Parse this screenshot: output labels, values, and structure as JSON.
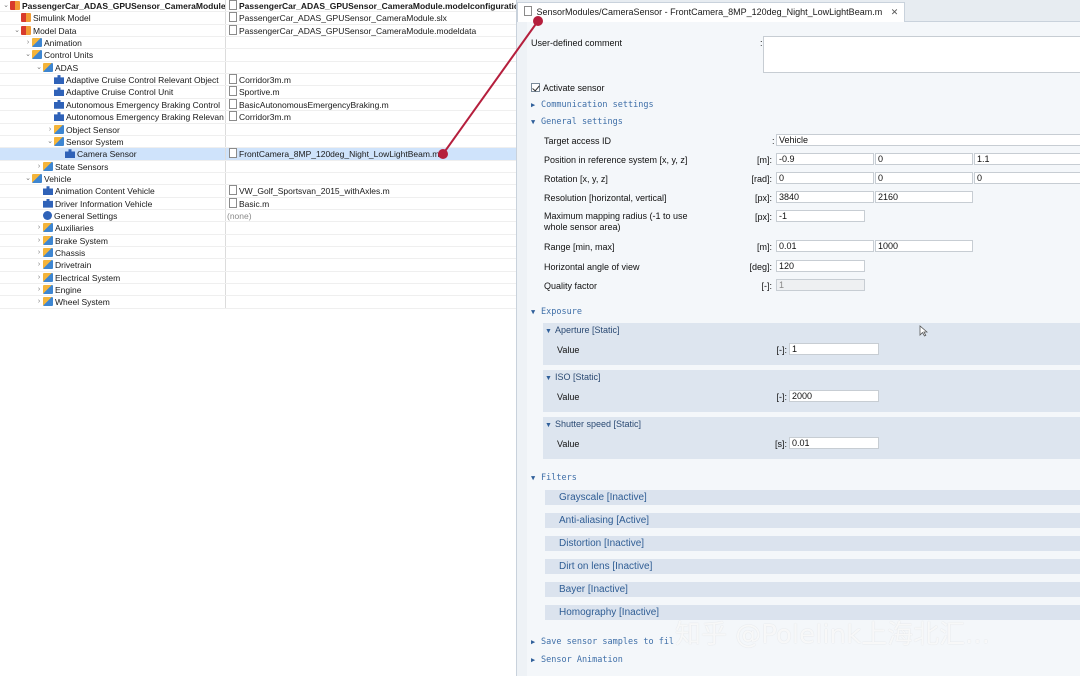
{
  "tree": {
    "rows": [
      {
        "indent": 0,
        "twisty": "v",
        "icon": "model",
        "name": "PassengerCar_ADAS_GPUSensor_CameraModule",
        "value": "PassengerCar_ADAS_GPUSensor_CameraModule.modelconfiguration",
        "bold": true
      },
      {
        "indent": 1,
        "twisty": "",
        "icon": "model",
        "name": "Simulink Model",
        "value": "PassengerCar_ADAS_GPUSensor_CameraModule.slx"
      },
      {
        "indent": 1,
        "twisty": "v",
        "icon": "model",
        "name": "Model Data",
        "value": "PassengerCar_ADAS_GPUSensor_CameraModule.modeldata"
      },
      {
        "indent": 2,
        "twisty": ">",
        "icon": "folder",
        "name": "Animation",
        "value": ""
      },
      {
        "indent": 2,
        "twisty": "v",
        "icon": "folder",
        "name": "Control Units",
        "value": ""
      },
      {
        "indent": 3,
        "twisty": "v",
        "icon": "folder",
        "name": "ADAS",
        "value": ""
      },
      {
        "indent": 4,
        "twisty": "",
        "icon": "puzzle",
        "name": "Adaptive Cruise Control Relevant Object",
        "value": "Corridor3m.m"
      },
      {
        "indent": 4,
        "twisty": "",
        "icon": "puzzle",
        "name": "Adaptive Cruise Control Unit",
        "value": "Sportive.m"
      },
      {
        "indent": 4,
        "twisty": "",
        "icon": "puzzle",
        "name": "Autonomous Emergency Braking Control",
        "value": "BasicAutonomousEmergencyBraking.m"
      },
      {
        "indent": 4,
        "twisty": "",
        "icon": "puzzle",
        "name": "Autonomous Emergency Braking Relevan",
        "value": "Corridor3m.m"
      },
      {
        "indent": 4,
        "twisty": ">",
        "icon": "folder",
        "name": "Object Sensor",
        "value": ""
      },
      {
        "indent": 4,
        "twisty": "v",
        "icon": "folder",
        "name": "Sensor System",
        "value": ""
      },
      {
        "indent": 5,
        "twisty": "",
        "icon": "puzzle",
        "name": "Camera Sensor",
        "value": "FrontCamera_8MP_120deg_Night_LowLightBeam.m",
        "selected": true
      },
      {
        "indent": 3,
        "twisty": ">",
        "icon": "folder",
        "name": "State Sensors",
        "value": ""
      },
      {
        "indent": 2,
        "twisty": "v",
        "icon": "folder",
        "name": "Vehicle",
        "value": ""
      },
      {
        "indent": 3,
        "twisty": "",
        "icon": "puzzle",
        "name": "Animation Content Vehicle",
        "value": "VW_Golf_Sportsvan_2015_withAxles.m"
      },
      {
        "indent": 3,
        "twisty": "",
        "icon": "puzzle",
        "name": "Driver Information Vehicle",
        "value": "Basic.m"
      },
      {
        "indent": 3,
        "twisty": "",
        "icon": "gear",
        "name": "General Settings",
        "value": "(none)",
        "none": true
      },
      {
        "indent": 3,
        "twisty": ">",
        "icon": "folder",
        "name": "Auxiliaries",
        "value": ""
      },
      {
        "indent": 3,
        "twisty": ">",
        "icon": "folder",
        "name": "Brake System",
        "value": ""
      },
      {
        "indent": 3,
        "twisty": ">",
        "icon": "folder",
        "name": "Chassis",
        "value": ""
      },
      {
        "indent": 3,
        "twisty": ">",
        "icon": "folder",
        "name": "Drivetrain",
        "value": ""
      },
      {
        "indent": 3,
        "twisty": ">",
        "icon": "folder",
        "name": "Electrical System",
        "value": ""
      },
      {
        "indent": 3,
        "twisty": ">",
        "icon": "folder",
        "name": "Engine",
        "value": ""
      },
      {
        "indent": 3,
        "twisty": ">",
        "icon": "folder",
        "name": "Wheel System",
        "value": ""
      }
    ]
  },
  "editor": {
    "tab_title": "SensorModules/CameraSensor - FrontCamera_8MP_120deg_Night_LowLightBeam.m",
    "tab_close": "✕",
    "comment_label": "User-defined comment",
    "comment_colon": ":",
    "comment_value": "",
    "activate_label": "Activate sensor",
    "sections": {
      "communication": "Communication settings",
      "general": "General settings",
      "exposure": "Exposure",
      "filters": "Filters",
      "save": "Save sensor samples to fil",
      "animation": "Sensor Animation"
    },
    "general": {
      "target_label": "Target access ID",
      "target_value": "Vehicle",
      "position_label": "Position in reference system [x, y, z]",
      "position_unit": "[m]:",
      "position_values": [
        "-0.9",
        "0",
        "1.1"
      ],
      "rotation_label": "Rotation [x, y, z]",
      "rotation_unit": "[rad]:",
      "rotation_values": [
        "0",
        "0",
        "0"
      ],
      "resolution_label": "Resolution [horizontal, vertical]",
      "resolution_unit": "[px]:",
      "resolution_values": [
        "3840",
        "2160"
      ],
      "mapping_label_1": "Maximum mapping radius (-1 to use",
      "mapping_label_2": "whole sensor area)",
      "mapping_unit": "[px]:",
      "mapping_value": "-1",
      "range_label": "Range [min, max]",
      "range_unit": "[m]:",
      "range_values": [
        "0.01",
        "1000"
      ],
      "angle_label": "Horizontal angle of view",
      "angle_unit": "[deg]:",
      "angle_value": "120",
      "quality_label": "Quality factor",
      "quality_unit": "[-]:",
      "quality_value": "1"
    },
    "exposure": {
      "aperture_title": "Aperture [Static]",
      "aperture_label": "Value",
      "aperture_unit": "[-]:",
      "aperture_value": "1",
      "iso_title": "ISO [Static]",
      "iso_label": "Value",
      "iso_unit": "[-]:",
      "iso_value": "2000",
      "shutter_title": "Shutter speed [Static]",
      "shutter_label": "Value",
      "shutter_unit": "[s]:",
      "shutter_value": "0.01"
    },
    "filters": [
      "Grayscale [Inactive]",
      "Anti-aliasing [Active]",
      "Distortion [Inactive]",
      "Dirt on lens [Inactive]",
      "Bayer [Inactive]",
      "Homography [Inactive]"
    ]
  },
  "watermark": "知乎 @Polelink上海北汇...",
  "colors": {
    "callout": "#b51f3d",
    "selection": "#cfe3fb",
    "section_text": "#3f6fa8"
  }
}
